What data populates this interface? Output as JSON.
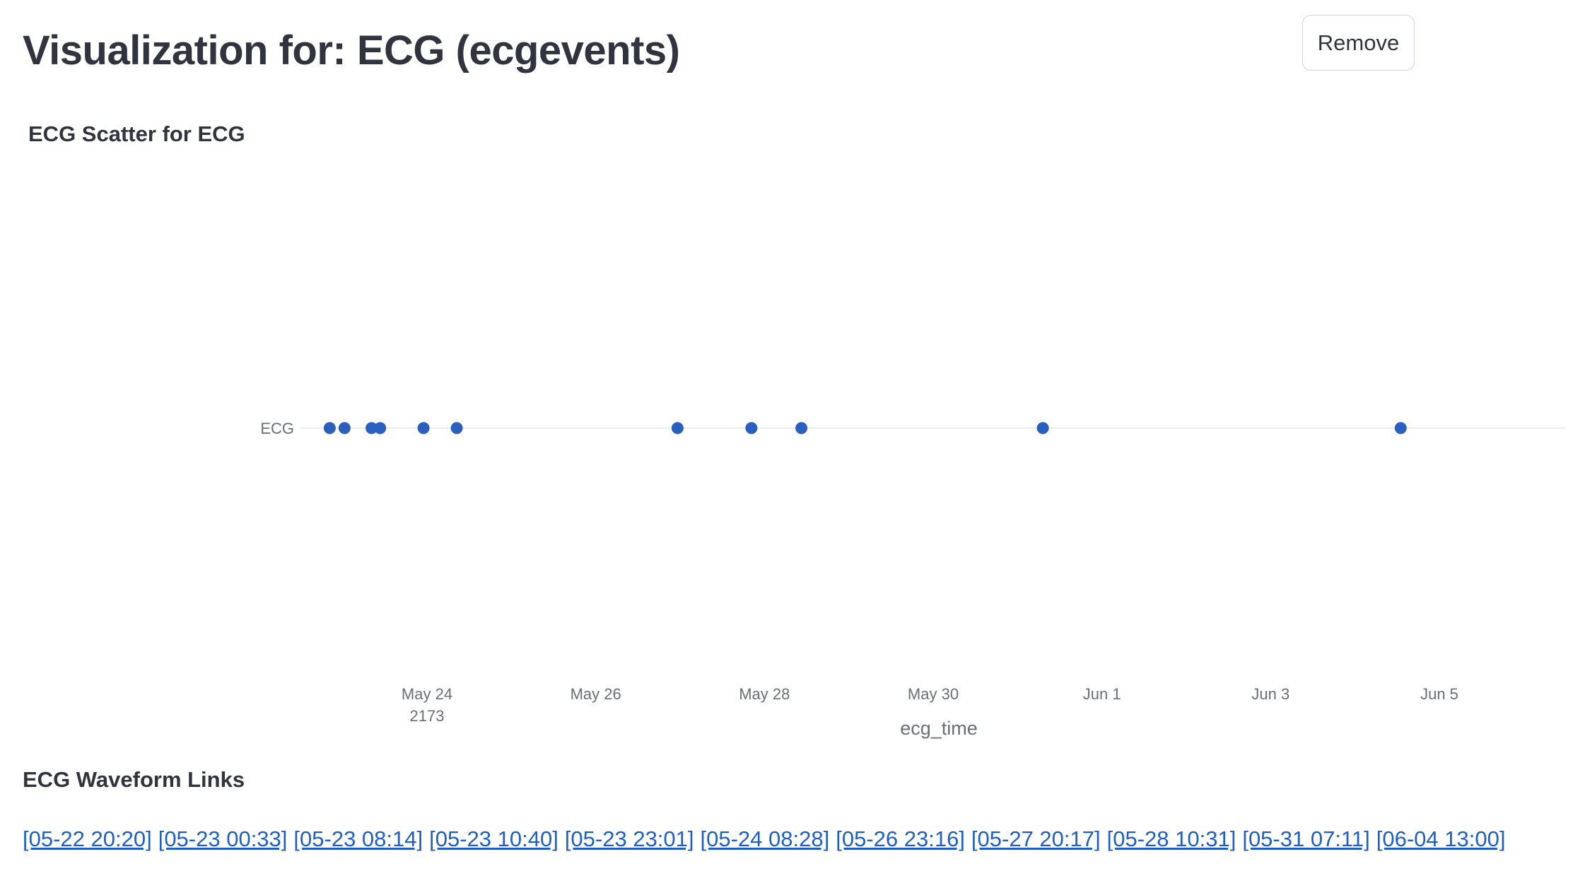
{
  "header": {
    "title": "Visualization for: ECG (ecgevents)",
    "remove_label": "Remove"
  },
  "chart_data": {
    "type": "scatter",
    "title": "ECG Scatter for ECG",
    "xlabel": "ecg_time",
    "ylabel": "",
    "categories": [
      "ECG"
    ],
    "year": "2173",
    "x_ticks": [
      "May 24",
      "May 26",
      "May 28",
      "May 30",
      "Jun 1",
      "Jun 3",
      "Jun 5"
    ],
    "xlim": [
      "2173-05-22 12:00",
      "2173-06-06 12:00"
    ],
    "grid": true,
    "marker_color": "#2a5fbf",
    "series": [
      {
        "category": "ECG",
        "x": [
          "2173-05-22 20:20",
          "2173-05-23 00:33",
          "2173-05-23 08:14",
          "2173-05-23 10:40",
          "2173-05-23 23:01",
          "2173-05-24 08:28",
          "2173-05-26 23:16",
          "2173-05-27 20:17",
          "2173-05-28 10:31",
          "2173-05-31 07:11",
          "2173-06-04 13:00"
        ]
      }
    ]
  },
  "links_section": {
    "title": "ECG Waveform Links",
    "links": [
      "[05-22 20:20]",
      "[05-23 00:33]",
      "[05-23 08:14]",
      "[05-23 10:40]",
      "[05-23 23:01]",
      "[05-24 08:28]",
      "[05-26 23:16]",
      "[05-27 20:17]",
      "[05-28 10:31]",
      "[05-31 07:11]",
      "[06-04 13:00]"
    ]
  }
}
